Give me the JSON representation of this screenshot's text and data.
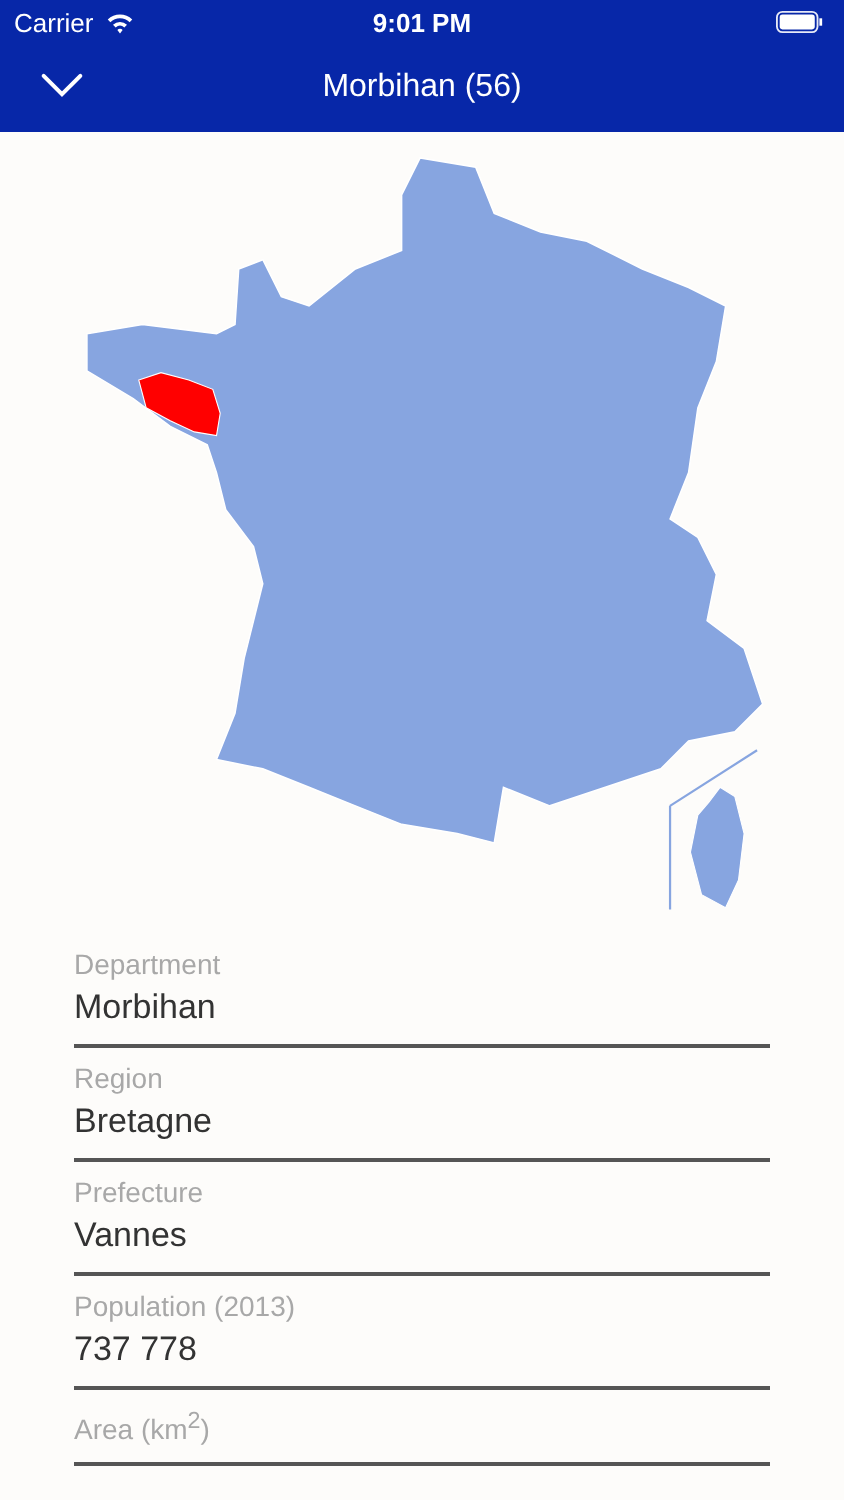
{
  "status_bar": {
    "carrier": "Carrier",
    "time": "9:01 PM"
  },
  "nav": {
    "title": "Morbihan (56)"
  },
  "fields": [
    {
      "label": "Department",
      "value": "Morbihan"
    },
    {
      "label": "Region",
      "value": "Bretagne"
    },
    {
      "label": "Prefecture",
      "value": "Vannes"
    },
    {
      "label": "Population (2013)",
      "value": "737 778"
    },
    {
      "label": "Area (km$^{2}$)"
    }
  ]
}
